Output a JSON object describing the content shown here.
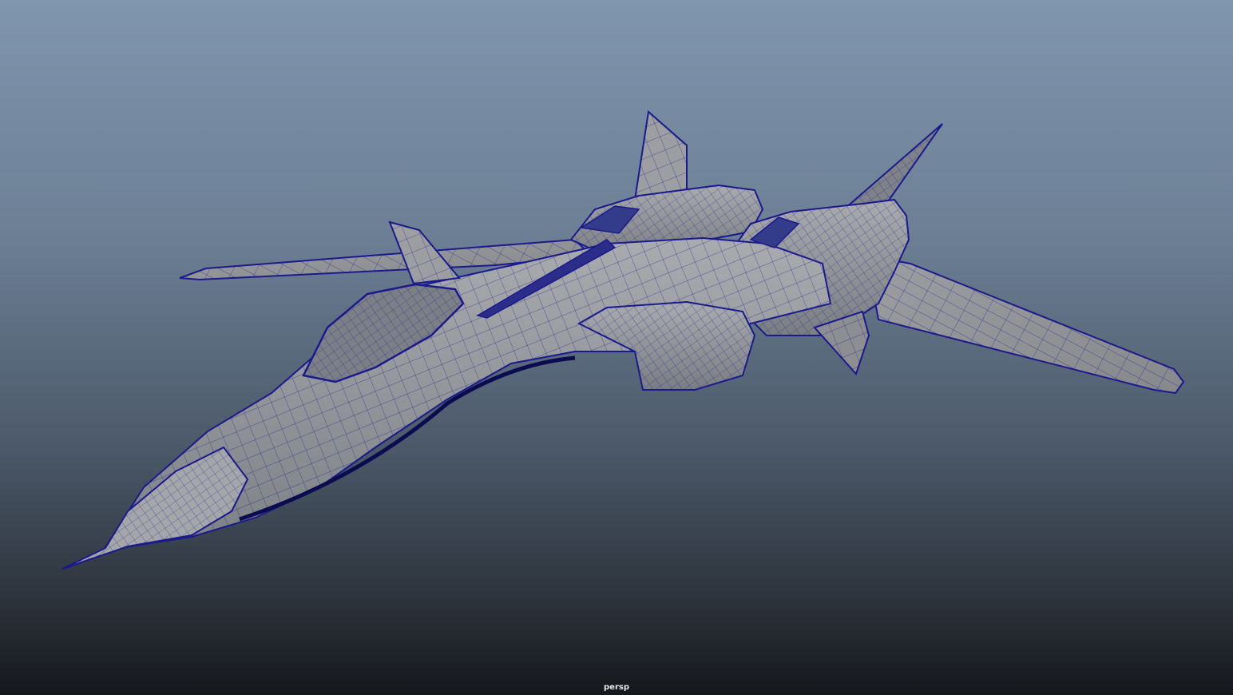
{
  "viewport": {
    "camera_name": "persp",
    "display_mode": "wireframe-on-shaded",
    "colors": {
      "background_top": "#8096ae",
      "background_bottom": "#15181c",
      "mesh_fill": "#909296",
      "mesh_fill_light": "#a9abaf",
      "mesh_fill_dark": "#6c6f75",
      "wireframe": "#1a1a8c"
    }
  },
  "model": {
    "type": "jet-fighter",
    "parts": [
      "nose-cone",
      "fuselage",
      "canopy",
      "left-wing",
      "right-wing",
      "left-vertical-fin",
      "right-vertical-fin",
      "left-engine-nacelle",
      "right-engine-nacelle",
      "canard",
      "intakes"
    ]
  }
}
